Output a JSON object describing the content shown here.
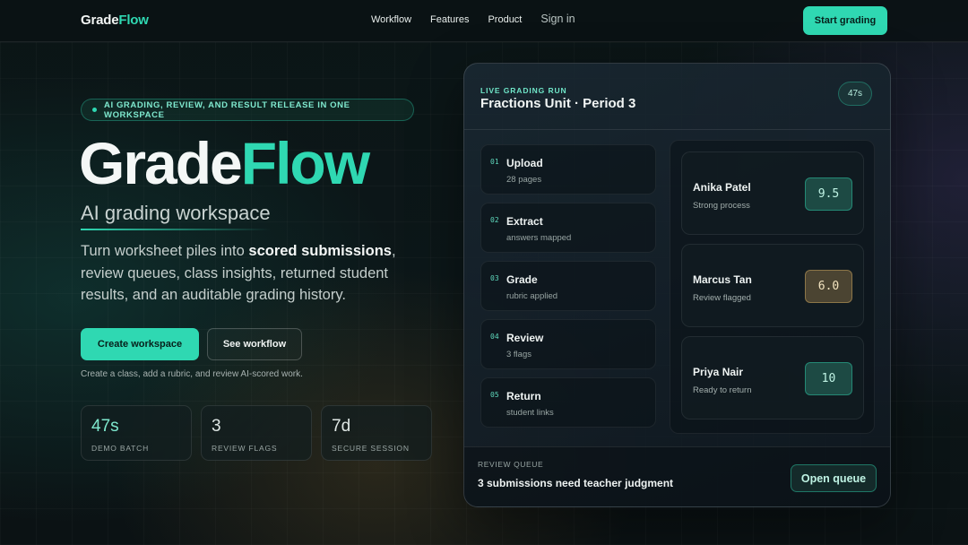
{
  "nav": {
    "logo_a": "Grade",
    "logo_b": "Flow",
    "links": [
      "Workflow",
      "Features",
      "Product"
    ],
    "signin": "Sign in",
    "cta": "Start grading"
  },
  "hero": {
    "pill": "AI GRADING, REVIEW, AND RESULT RELEASE IN ONE WORKSPACE",
    "title_a": "Grade",
    "title_b": "Flow",
    "subtitle": "AI grading workspace",
    "desc_pre": "Turn worksheet piles into ",
    "desc_bold": "scored submissions",
    "desc_post": ", review queues, class insights, returned student results, and an auditable grading history.",
    "primary_btn": "Create workspace",
    "secondary_btn": "See workflow",
    "helper": "Create a class, add a rubric, and review AI-scored work.",
    "stats": [
      {
        "value": "47s",
        "label": "DEMO BATCH"
      },
      {
        "value": "3",
        "label": "REVIEW FLAGS"
      },
      {
        "value": "7d",
        "label": "SECURE SESSION"
      }
    ]
  },
  "panel": {
    "live_label": "LIVE GRADING RUN",
    "title": "Fractions Unit · Period 3",
    "timer": "47s",
    "steps": [
      {
        "num": "01",
        "title": "Upload",
        "sub": "28 pages"
      },
      {
        "num": "02",
        "title": "Extract",
        "sub": "answers mapped"
      },
      {
        "num": "03",
        "title": "Grade",
        "sub": "rubric applied"
      },
      {
        "num": "04",
        "title": "Review",
        "sub": "3 flags"
      },
      {
        "num": "05",
        "title": "Return",
        "sub": "student links"
      }
    ],
    "students": [
      {
        "name": "Anika Patel",
        "status": "Strong process",
        "score": "9.5"
      },
      {
        "name": "Marcus Tan",
        "status": "Review flagged",
        "score": "6.0"
      },
      {
        "name": "Priya Nair",
        "status": "Ready to return",
        "score": "10"
      }
    ],
    "queue_label": "REVIEW QUEUE",
    "queue_text": "3 submissions need teacher judgment",
    "queue_btn": "Open queue"
  },
  "colors": {
    "accent": "#2fd8b2",
    "warn": "#4b4432",
    "background": "#0b1516"
  }
}
